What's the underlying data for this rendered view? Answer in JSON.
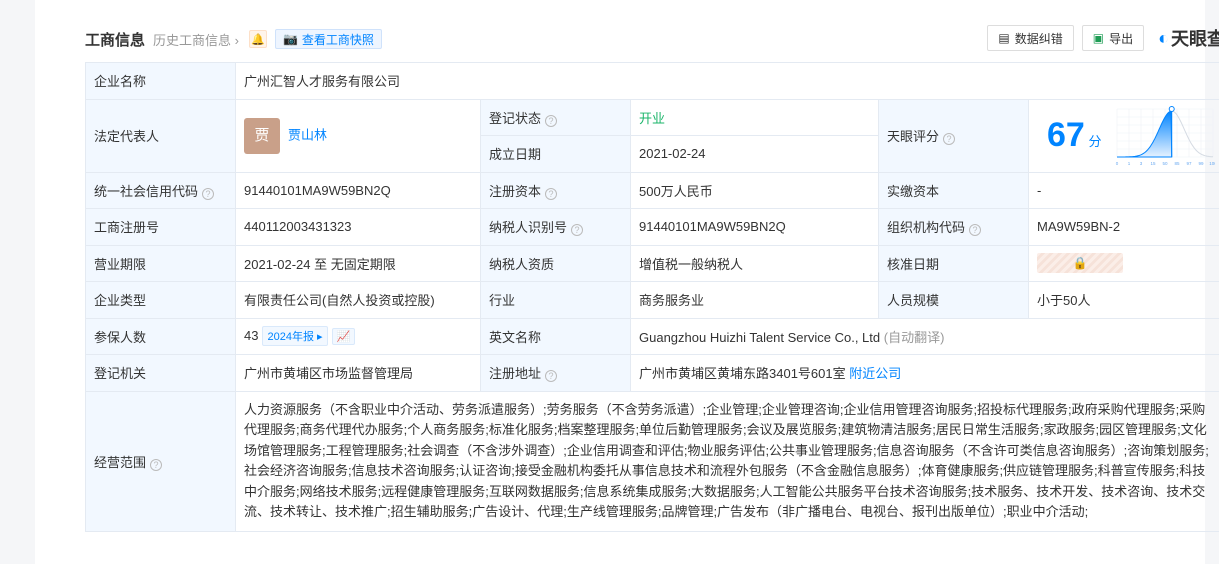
{
  "header": {
    "title": "工商信息",
    "history": "历史工商信息 ›",
    "snapshot": "查看工商快照",
    "correction": "数据纠错",
    "export": "导出",
    "logo": "天眼查"
  },
  "rows": {
    "company_name_label": "企业名称",
    "company_name": "广州汇智人才服务有限公司",
    "legal_rep_label": "法定代表人",
    "legal_rep_avatar": "贾",
    "legal_rep": "贾山林",
    "reg_status_label": "登记状态",
    "reg_status": "开业",
    "est_date_label": "成立日期",
    "est_date": "2021-02-24",
    "score_label": "天眼评分",
    "score": "67",
    "score_unit": "分",
    "credit_code_label": "统一社会信用代码",
    "credit_code": "91440101MA9W59BN2Q",
    "reg_capital_label": "注册资本",
    "reg_capital": "500万人民币",
    "paid_capital_label": "实缴资本",
    "paid_capital": "-",
    "reg_no_label": "工商注册号",
    "reg_no": "440112003431323",
    "tax_id_label": "纳税人识别号",
    "tax_id": "91440101MA9W59BN2Q",
    "org_code_label": "组织机构代码",
    "org_code": "MA9W59BN-2",
    "term_label": "营业期限",
    "term": "2021-02-24 至 无固定期限",
    "taxpayer_label": "纳税人资质",
    "taxpayer": "增值税一般纳税人",
    "approve_label": "核准日期",
    "type_label": "企业类型",
    "type": "有限责任公司(自然人投资或控股)",
    "industry_label": "行业",
    "industry": "商务服务业",
    "staff_label": "人员规模",
    "staff": "小于50人",
    "insured_label": "参保人数",
    "insured": "43",
    "insured_report": "2024年报 ▸",
    "english_label": "英文名称",
    "english": "Guangzhou Huizhi Talent Service Co., Ltd",
    "english_note": "(自动翻译)",
    "authority_label": "登记机关",
    "authority": "广州市黄埔区市场监督管理局",
    "address_label": "注册地址",
    "address": "广州市黄埔区黄埔东路3401号601室",
    "address_link": "附近公司",
    "scope_label": "经营范围",
    "scope": "人力资源服务（不含职业中介活动、劳务派遣服务）;劳务服务（不含劳务派遣）;企业管理;企业管理咨询;企业信用管理咨询服务;招投标代理服务;政府采购代理服务;采购代理服务;商务代理代办服务;个人商务服务;标准化服务;档案整理服务;单位后勤管理服务;会议及展览服务;建筑物清洁服务;居民日常生活服务;家政服务;园区管理服务;文化场馆管理服务;工程管理服务;社会调查（不含涉外调查）;企业信用调查和评估;物业服务评估;公共事业管理服务;信息咨询服务（不含许可类信息咨询服务）;咨询策划服务;社会经济咨询服务;信息技术咨询服务;认证咨询;接受金融机构委托从事信息技术和流程外包服务（不含金融信息服务）;体育健康服务;供应链管理服务;科普宣传服务;科技中介服务;网络技术服务;远程健康管理服务;互联网数据服务;信息系统集成服务;大数据服务;人工智能公共服务平台技术咨询服务;技术服务、技术开发、技术咨询、技术交流、技术转让、技术推广;招生辅助服务;广告设计、代理;生产线管理服务;品牌管理;广告发布（非广播电台、电视台、报刊出版单位）;职业中介活动;"
  },
  "score_chart": {
    "ticks": [
      "0",
      "1",
      "3",
      "15",
      "50",
      "85",
      "97",
      "99",
      "100"
    ],
    "percentile": 67,
    "accent": "#0084ff"
  }
}
